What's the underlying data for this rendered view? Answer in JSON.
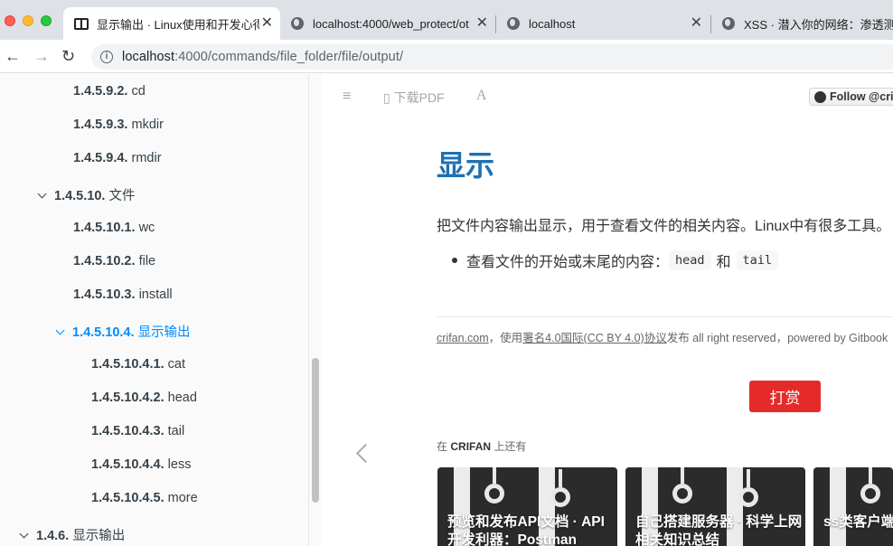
{
  "browser": {
    "tabs": [
      {
        "title": "显示输出 · Linux使用和开发心得",
        "active": true,
        "icon": "book-icon"
      },
      {
        "title": "localhost:4000/web_protect/ot",
        "active": false,
        "icon": "globe-icon"
      },
      {
        "title": "localhost",
        "active": false,
        "icon": "globe-icon"
      },
      {
        "title": "XSS · 潜入你的网络：渗透测试",
        "active": false,
        "icon": "globe-icon"
      }
    ],
    "close_glyph": "✕",
    "back_glyph": "←",
    "forward_glyph": "→",
    "reload_glyph": "↻",
    "info_glyph": "i",
    "url_host": "localhost",
    "url_path": ":4000/commands/file_folder/file/output/"
  },
  "sidebar": {
    "items": [
      {
        "number": "1.4.5.9.2.",
        "label": "cd"
      },
      {
        "number": "1.4.5.9.3.",
        "label": "mkdir"
      },
      {
        "number": "1.4.5.9.4.",
        "label": "rmdir"
      },
      {
        "number": "1.4.5.10.",
        "label": "文件"
      },
      {
        "number": "1.4.5.10.1.",
        "label": "wc"
      },
      {
        "number": "1.4.5.10.2.",
        "label": "file"
      },
      {
        "number": "1.4.5.10.3.",
        "label": "install"
      },
      {
        "number": "1.4.5.10.4.",
        "label": "显示输出"
      },
      {
        "number": "1.4.5.10.4.1.",
        "label": "cat"
      },
      {
        "number": "1.4.5.10.4.2.",
        "label": "head"
      },
      {
        "number": "1.4.5.10.4.3.",
        "label": "tail"
      },
      {
        "number": "1.4.5.10.4.4.",
        "label": "less"
      },
      {
        "number": "1.4.5.10.4.5.",
        "label": "more"
      },
      {
        "number": "1.4.6.",
        "label": "显示输出"
      }
    ]
  },
  "header": {
    "menu_glyph": "≡",
    "pdf_label": "下载PDF",
    "font_label": "A",
    "follow_label": "Follow @cri"
  },
  "page": {
    "title": "显示",
    "intro": "把文件内容输出显示，用于查看文件的相关内容。Linux中有很多工具。",
    "bullet_text": "查看文件的开始或末尾的内容：",
    "code_head": "head",
    "bullet_and": "和",
    "code_tail": "tail",
    "footer_site": "crifan.com",
    "footer_mid": "，使用",
    "footer_license": "署名4.0国际(CC BY 4.0)协议",
    "footer_rest": "发布 all right reserved，powered by Gitbook",
    "donate_label": "打赏",
    "also_prefix": "在",
    "also_brand": "CRIFAN",
    "also_suffix": "上还有",
    "cards": [
      {
        "title": "预览和发布API文档 · API开发利器：Postman"
      },
      {
        "title": "自己搭建服务器 · 科学上网相关知识总结"
      },
      {
        "title": "ss类客户端 · 科学上网相"
      }
    ]
  },
  "colors": {
    "accent": "#008cff",
    "title_blue": "#1f6fb5",
    "donate_red": "#e52a2a"
  }
}
